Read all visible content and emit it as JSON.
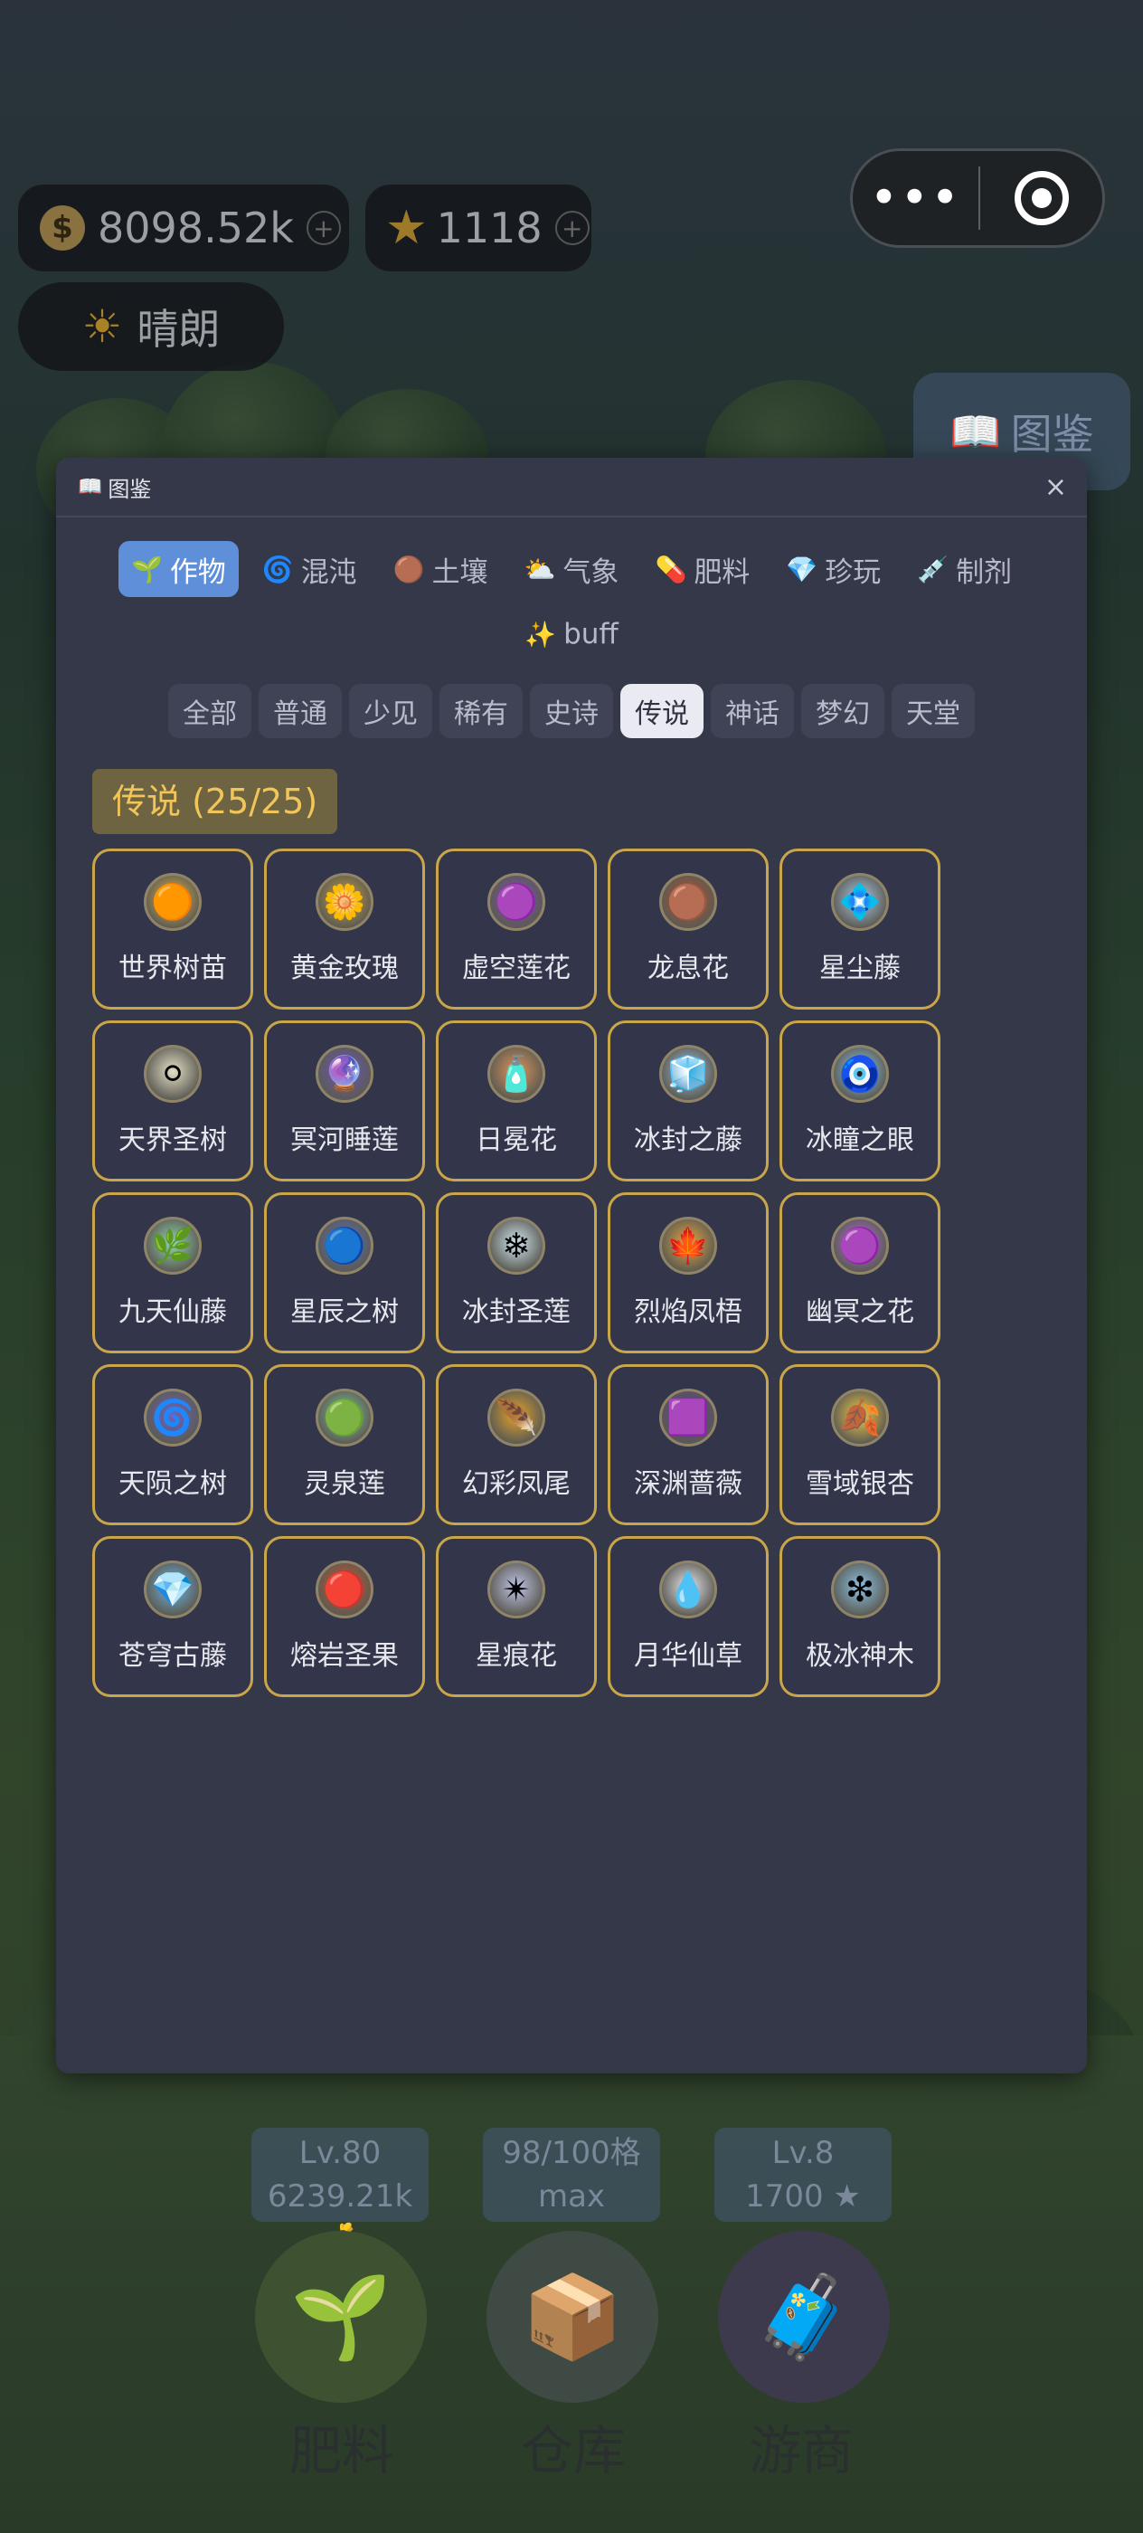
{
  "hud": {
    "coins": "8098.52k",
    "stars": "1118",
    "plus": "+",
    "weather": "晴朗",
    "tujian": "图鉴",
    "coin_symbol": "$"
  },
  "modal": {
    "title": "图鉴",
    "close": "×",
    "categories": [
      {
        "icon": "sprout-icon",
        "glyph": "🌱",
        "label": "作物",
        "active": true
      },
      {
        "icon": "swirl-icon",
        "glyph": "🌀",
        "label": "混沌",
        "active": false
      },
      {
        "icon": "soil-icon",
        "glyph": "🟤",
        "label": "土壤",
        "active": false
      },
      {
        "icon": "weather-icon",
        "glyph": "⛅",
        "label": "气象",
        "active": false
      },
      {
        "icon": "pill-icon",
        "glyph": "💊",
        "label": "肥料",
        "active": false
      },
      {
        "icon": "gem-icon",
        "glyph": "💎",
        "label": "珍玩",
        "active": false
      },
      {
        "icon": "syringe-icon",
        "glyph": "💉",
        "label": "制剂",
        "active": false
      },
      {
        "icon": "sparkles-icon",
        "glyph": "✨",
        "label": "buff",
        "active": false
      }
    ],
    "rarities": [
      {
        "label": "全部",
        "active": false
      },
      {
        "label": "普通",
        "active": false
      },
      {
        "label": "少见",
        "active": false
      },
      {
        "label": "稀有",
        "active": false
      },
      {
        "label": "史诗",
        "active": false
      },
      {
        "label": "传说",
        "active": true
      },
      {
        "label": "神话",
        "active": false
      },
      {
        "label": "梦幻",
        "active": false
      },
      {
        "label": "天堂",
        "active": false
      }
    ],
    "section_title": "传说 (25/25)",
    "items": [
      {
        "name": "世界树苗",
        "icon": "golden-seed-icon",
        "glyph": "🟠",
        "color": "#e8b84a"
      },
      {
        "name": "黄金玫瑰",
        "icon": "golden-rose-icon",
        "glyph": "🌼",
        "color": "#c9a040"
      },
      {
        "name": "虚空莲花",
        "icon": "void-lotus-icon",
        "glyph": "🟣",
        "color": "#7b4fb8"
      },
      {
        "name": "龙息花",
        "icon": "dragon-seed-icon",
        "glyph": "🟤",
        "color": "#b2532f"
      },
      {
        "name": "星尘藤",
        "icon": "stardust-vine-icon",
        "glyph": "💠",
        "color": "#a9c8e6"
      },
      {
        "name": "天界圣树",
        "icon": "celestial-tree-icon",
        "glyph": "⚪",
        "color": "#e4dfc6"
      },
      {
        "name": "冥河睡莲",
        "icon": "styx-lotus-icon",
        "glyph": "🔮",
        "color": "#6a58c2"
      },
      {
        "name": "日冕花",
        "icon": "corona-bottle-icon",
        "glyph": "🧴",
        "color": "#e1955a"
      },
      {
        "name": "冰封之藤",
        "icon": "frozen-vine-icon",
        "glyph": "🧊",
        "color": "#9fc0dc"
      },
      {
        "name": "冰瞳之眼",
        "icon": "ice-eye-icon",
        "glyph": "🧿",
        "color": "#8cc7ea"
      },
      {
        "name": "九天仙藤",
        "icon": "jade-vine-icon",
        "glyph": "🌿",
        "color": "#8fd3b1"
      },
      {
        "name": "星辰之树",
        "icon": "star-orb-icon",
        "glyph": "🔵",
        "color": "#5b6fc8"
      },
      {
        "name": "冰封圣莲",
        "icon": "ice-lotus-icon",
        "glyph": "❄",
        "color": "#cfe6f2"
      },
      {
        "name": "烈焰凤梧",
        "icon": "flame-leaf-icon",
        "glyph": "🍁",
        "color": "#e8a53c"
      },
      {
        "name": "幽冥之花",
        "icon": "nether-flower-icon",
        "glyph": "🟣",
        "color": "#b06be0"
      },
      {
        "name": "天陨之树",
        "icon": "meteor-tree-icon",
        "glyph": "🌀",
        "color": "#6b63c0"
      },
      {
        "name": "灵泉莲",
        "icon": "spirit-lotus-icon",
        "glyph": "🟢",
        "color": "#7ec8a0"
      },
      {
        "name": "幻彩凤尾",
        "icon": "phoenix-feather-icon",
        "glyph": "🪶",
        "color": "#e5a32b"
      },
      {
        "name": "深渊蔷薇",
        "icon": "abyss-rose-icon",
        "glyph": "🟪",
        "color": "#5a3a9c"
      },
      {
        "name": "雪域银杏",
        "icon": "ginkgo-leaf-icon",
        "glyph": "🍂",
        "color": "#f0c846"
      },
      {
        "name": "苍穹古藤",
        "icon": "sky-vine-icon",
        "glyph": "💎",
        "color": "#6cb6e6"
      },
      {
        "name": "熔岩圣果",
        "icon": "lava-fruit-icon",
        "glyph": "🔴",
        "color": "#d4532a"
      },
      {
        "name": "星痕花",
        "icon": "star-mark-icon",
        "glyph": "✴",
        "color": "#c0c4e8"
      },
      {
        "name": "月华仙草",
        "icon": "moon-drop-icon",
        "glyph": "💧",
        "color": "#e6e6ee"
      },
      {
        "name": "极冰神木",
        "icon": "ice-rune-icon",
        "glyph": "❇",
        "color": "#88c2e6"
      }
    ]
  },
  "bottom": {
    "level_label": "Lv.80",
    "level_sub": "6239.21k 💰",
    "slots_label": "98/100格",
    "slots_sub": "max",
    "merchant_level": "Lv.8",
    "merchant_sub": "1700 ★",
    "btn_fertilizer": "肥料",
    "btn_warehouse": "仓库",
    "btn_merchant": "游商"
  }
}
